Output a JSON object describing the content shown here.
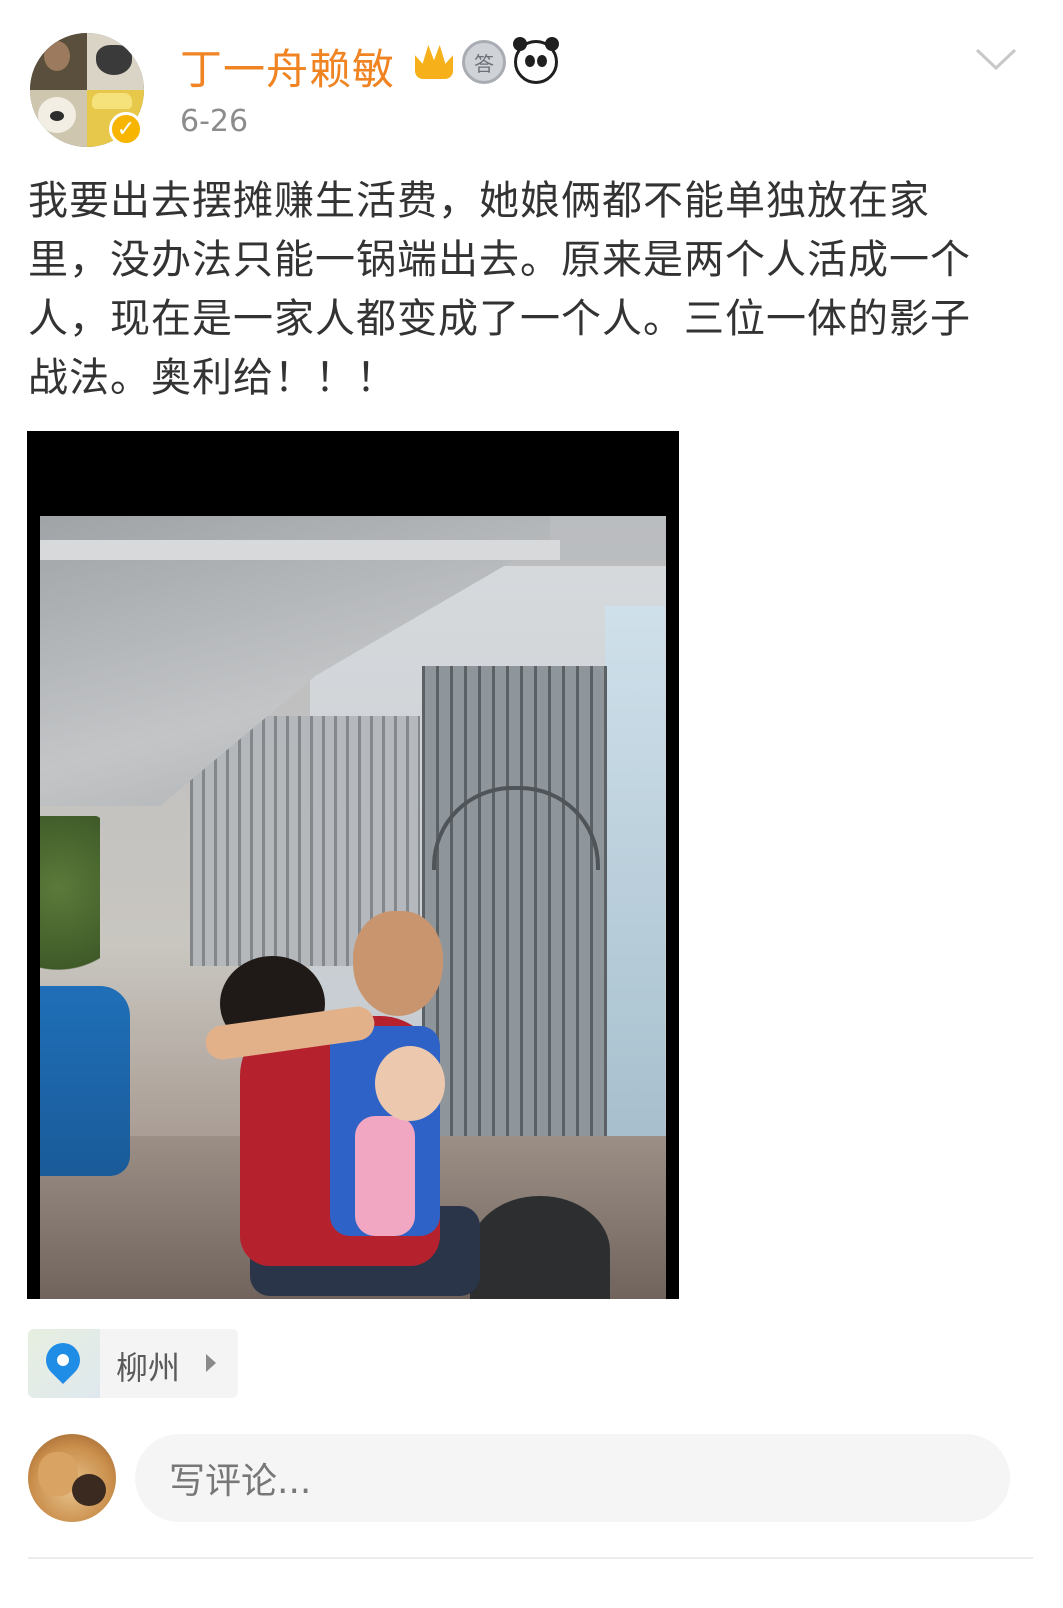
{
  "post": {
    "author": {
      "name": "丁一舟赖敏",
      "verified_icon": "verified-v-badge",
      "badges": [
        "crown-badge-icon",
        "medal-badge-icon",
        "panda-badge-icon"
      ]
    },
    "date": "6-26",
    "menu_icon": "chevron-down-icon",
    "text": "我要出去摆摊赚生活费，她娘俩都不能单独放在家里，没办法只能一锅端出去。原来是两个人活成一个人，现在是一家人都变成了一个人。三位一体的影子战法。奥利给！！！",
    "location": {
      "icon": "location-pin-icon",
      "label": "柳州"
    }
  },
  "comment_bar": {
    "placeholder": "写评论..."
  },
  "colors": {
    "username": "#f08322",
    "verified": "#f7b500",
    "location_pin": "#1f8ce6"
  }
}
